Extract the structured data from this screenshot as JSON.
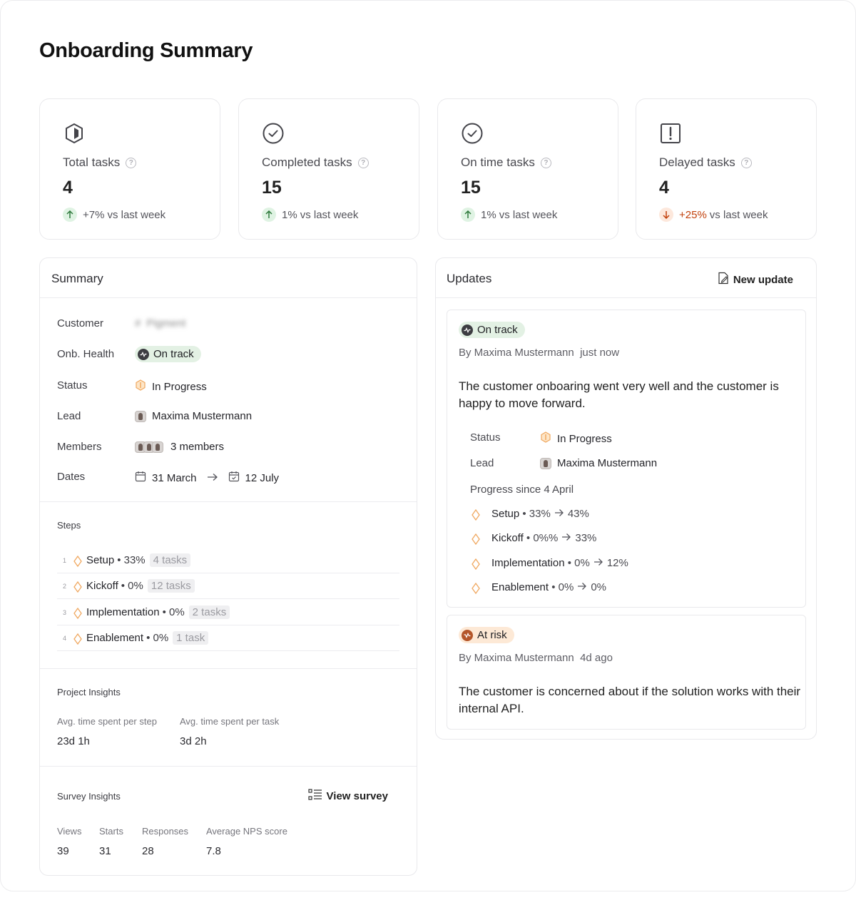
{
  "page": {
    "title": "Onboarding Summary"
  },
  "kpis": [
    {
      "label": "Total tasks",
      "value": "4",
      "trend_value": "+7%",
      "trend_suffix": "vs last week",
      "direction": "up",
      "icon": "box-icon"
    },
    {
      "label": "Completed tasks",
      "value": "15",
      "trend_value": "1%",
      "trend_suffix": "vs last week",
      "direction": "up",
      "icon": "check-circle-icon"
    },
    {
      "label": "On time tasks",
      "value": "15",
      "trend_value": "1%",
      "trend_suffix": "vs last week",
      "direction": "up",
      "icon": "check-circle-icon"
    },
    {
      "label": "Delayed tasks",
      "value": "4",
      "trend_value": "+25%",
      "trend_suffix": "vs last week",
      "direction": "down",
      "icon": "alert-square-icon"
    }
  ],
  "summary": {
    "title": "Summary",
    "fields": {
      "customer_label": "Customer",
      "customer_value": "Pigment",
      "health_label": "Onb. Health",
      "health_value": "On track",
      "status_label": "Status",
      "status_value": "In Progress",
      "lead_label": "Lead",
      "lead_value": "Maxima Mustermann",
      "members_label": "Members",
      "members_value": "3 members",
      "dates_label": "Dates",
      "start_date": "31 March",
      "end_date": "12 July"
    },
    "steps_title": "Steps",
    "steps": [
      {
        "num": "1",
        "name": "Setup",
        "pct": "33%",
        "tasks": "4 tasks"
      },
      {
        "num": "2",
        "name": "Kickoff",
        "pct": "0%",
        "tasks": "12 tasks"
      },
      {
        "num": "3",
        "name": "Implementation",
        "pct": "0%",
        "tasks": "2 tasks"
      },
      {
        "num": "4",
        "name": "Enablement",
        "pct": "0%",
        "tasks": "1 task"
      }
    ],
    "project_insights": {
      "title": "Project Insights",
      "avg_step_label": "Avg. time spent per step",
      "avg_step_value": "23d 1h",
      "avg_task_label": "Avg. time spent per task",
      "avg_task_value": "3d 2h"
    },
    "survey_insights": {
      "title": "Survey Insights",
      "view_survey_label": "View survey",
      "views_label": "Views",
      "views_value": "39",
      "starts_label": "Starts",
      "starts_value": "31",
      "responses_label": "Responses",
      "responses_value": "28",
      "nps_label": "Average NPS score",
      "nps_value": "7.8"
    }
  },
  "updates": {
    "title": "Updates",
    "new_update_label": "New update",
    "items": [
      {
        "badge": "On track",
        "author": "By Maxima Mustermann",
        "time": "just now",
        "text": "The customer onboaring went very well and the customer is happy to move forward.",
        "status_label": "Status",
        "status_value": "In Progress",
        "lead_label": "Lead",
        "lead_value": "Maxima Mustermann",
        "progress_label": "Progress since 4 April",
        "progress": [
          {
            "name": "Setup",
            "from": "33%",
            "to": "43%"
          },
          {
            "name": "Kickoff",
            "from": "0%%",
            "to": "33%"
          },
          {
            "name": "Implementation",
            "from": "0%",
            "to": "12%"
          },
          {
            "name": "Enablement",
            "from": "0%",
            "to": "0%"
          }
        ]
      },
      {
        "badge": "At risk",
        "author": "By Maxima Mustermann",
        "time": "4d ago",
        "text": "The customer is concerned about if the solution works with their internal API."
      }
    ]
  },
  "colors": {
    "green_pill": "#e3f1e4",
    "orange_pill": "#fde9d6",
    "trend_down": "#c2410c",
    "step_icon": "#f0a860"
  }
}
